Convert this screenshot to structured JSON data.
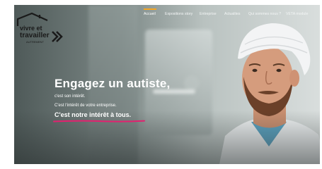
{
  "logo": {
    "line1": "vivre et",
    "line2": "travailler",
    "line3": "AUTREMENT"
  },
  "nav": {
    "items": [
      {
        "label": "Accueil",
        "active": true
      },
      {
        "label": "Expositions story",
        "active": false
      },
      {
        "label": "Entreprise",
        "active": false
      },
      {
        "label": "Actualites",
        "active": false
      },
      {
        "label": "Qui sommes nous ?",
        "active": false
      },
      {
        "label": "VETA module",
        "active": false
      }
    ]
  },
  "hero": {
    "title": "Engagez un autiste,",
    "line1": "c'est son intérêt.",
    "line2": "C'est l'intérêt de votre entreprise.",
    "line3": "C'est notre intérêt à tous."
  },
  "colors": {
    "nav_active_accent": "#f5a623",
    "highlight_underline": "#e3206f",
    "text": "#ffffff"
  }
}
